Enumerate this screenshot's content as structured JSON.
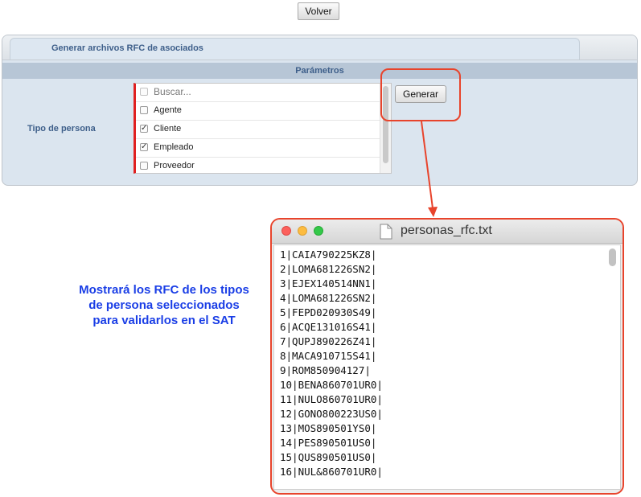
{
  "toolbar": {
    "volver_label": "Volver"
  },
  "panel": {
    "tab_label": "Generar archivos RFC de asociados",
    "section_title": "Parámetros",
    "tipo_label": "Tipo de persona",
    "search_placeholder": "Buscar...",
    "options": [
      {
        "label": "Agente",
        "checked": false,
        "mark": ""
      },
      {
        "label": "Cliente",
        "checked": true,
        "mark": "✓"
      },
      {
        "label": "Empleado",
        "checked": true,
        "mark": "✓"
      },
      {
        "label": "Proveedor",
        "checked": false,
        "mark": ""
      }
    ],
    "generar_label": "Generar"
  },
  "annotation": {
    "text": "Mostrará los RFC de los tipos de persona seleccionados para validarlos en el SAT",
    "color": "#1a3ee6",
    "highlight_color": "#e8442c"
  },
  "file_window": {
    "title": "personas_rfc.txt",
    "lines": [
      "1|CAIA790225KZ8|",
      "2|LOMA681226SN2|",
      "3|EJEX140514NN1|",
      "4|LOMA681226SN2|",
      "5|FEPD020930S49|",
      "6|ACQE131016S41|",
      "7|QUPJ890226Z41|",
      "8|MACA910715S41|",
      "9|ROM850904127|",
      "10|BENA860701UR0|",
      "11|NULO860701UR0|",
      "12|GONO800223US0|",
      "13|MOS890501YS0|",
      "14|PES890501US0|",
      "15|QUS890501US0|",
      "16|NUL&860701UR0|"
    ]
  }
}
